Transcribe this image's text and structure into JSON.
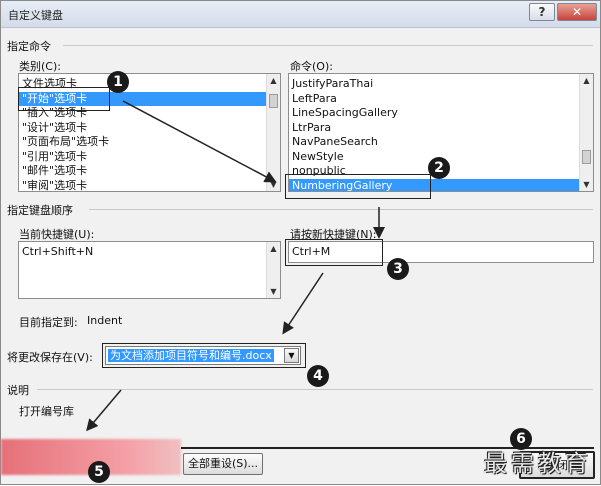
{
  "window": {
    "title": "自定义键盘",
    "help_glyph": "?",
    "close_glyph": "✕"
  },
  "specify_command": {
    "section_label": "指定命令",
    "categories_label": "类别(C):",
    "categories": [
      {
        "label": "文件选项卡",
        "selected": false
      },
      {
        "label": "\"开始\"选项卡",
        "selected": true
      },
      {
        "label": "\"插入\"选项卡",
        "selected": false
      },
      {
        "label": "\"设计\"选项卡",
        "selected": false
      },
      {
        "label": "\"页面布局\"选项卡",
        "selected": false
      },
      {
        "label": "\"引用\"选项卡",
        "selected": false
      },
      {
        "label": "\"邮件\"选项卡",
        "selected": false
      },
      {
        "label": "\"审阅\"选项卡",
        "selected": false
      }
    ],
    "commands_label": "命令(O):",
    "commands": [
      {
        "label": "JustifyParaThai",
        "selected": false
      },
      {
        "label": "LeftPara",
        "selected": false
      },
      {
        "label": "LineSpacingGallery",
        "selected": false
      },
      {
        "label": "LtrPara",
        "selected": false
      },
      {
        "label": "NavPaneSearch",
        "selected": false
      },
      {
        "label": "NewStyle",
        "selected": false
      },
      {
        "label": "nonpublic",
        "selected": false
      },
      {
        "label": "NumberingGallery",
        "selected": true
      }
    ]
  },
  "keyboard_sequence": {
    "section_label": "指定键盘顺序",
    "current_keys_label": "当前快捷键(U):",
    "current_keys": [
      "Ctrl+Shift+N"
    ],
    "new_key_label": "请按新快捷键(N):",
    "new_key_value": "Ctrl+M",
    "assigned_label": "目前指定到:",
    "assigned_value": "Indent"
  },
  "save_in": {
    "label": "将更改保存在(V):",
    "value": "为文档添加项目符号和编号.docx",
    "arrow": "▼"
  },
  "description": {
    "section_label": "说明",
    "text": "打开编号库"
  },
  "buttons": {
    "reset_all": "全部重设(S)...",
    "close": "关闭"
  },
  "annotations": {
    "markers": [
      "1",
      "2",
      "3",
      "4",
      "5",
      "6"
    ]
  },
  "watermark": "最需教育"
}
